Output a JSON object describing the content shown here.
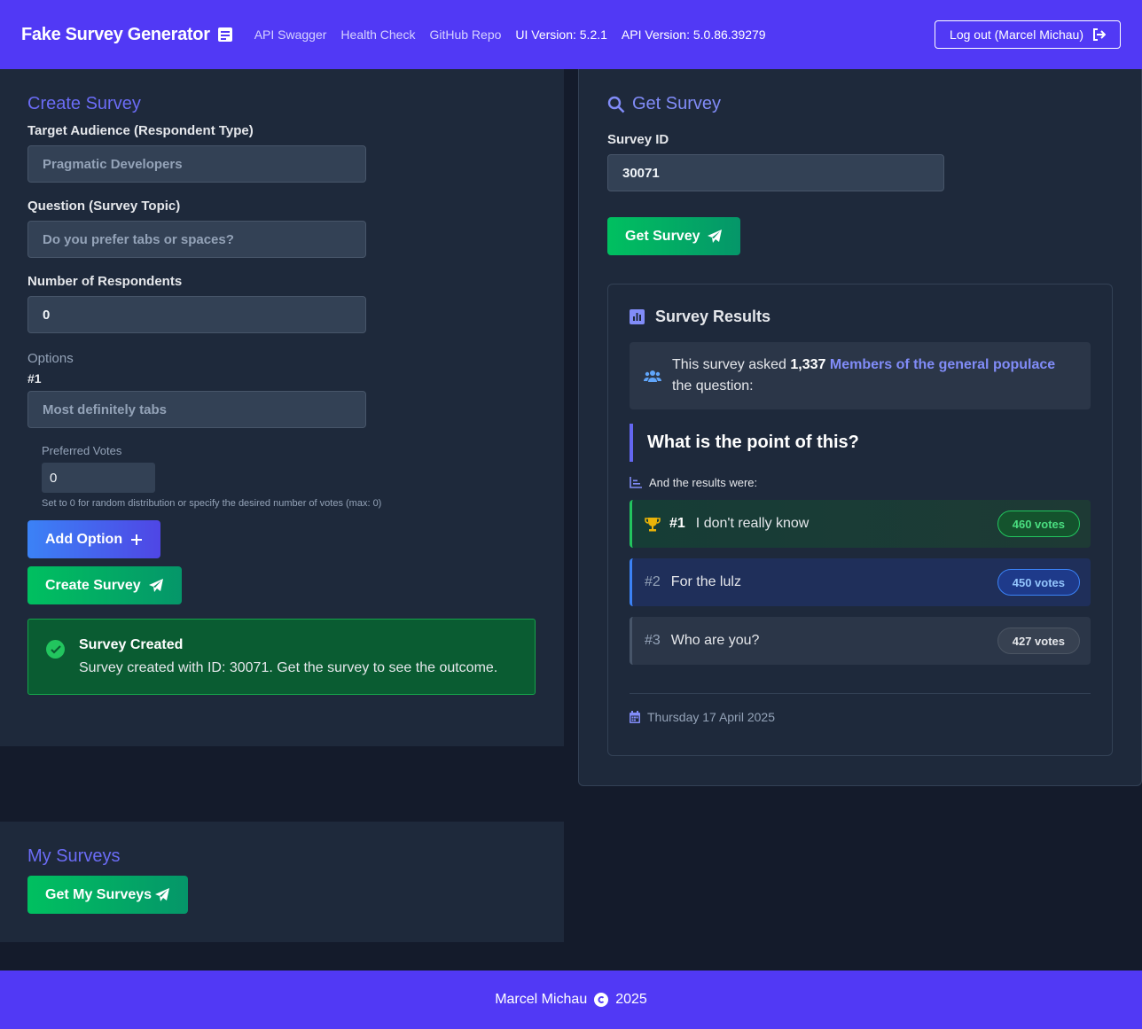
{
  "navbar": {
    "brand": "Fake Survey Generator",
    "links": [
      "API Swagger",
      "Health Check",
      "GitHub Repo"
    ],
    "ui_version": "UI Version: 5.2.1",
    "api_version": "API Version: 5.0.86.39279",
    "logout_label": "Log out (Marcel Michau)"
  },
  "create": {
    "title": "Create Survey",
    "audience_label": "Target Audience (Respondent Type)",
    "audience_placeholder": "Pragmatic Developers",
    "question_label": "Question (Survey Topic)",
    "question_placeholder": "Do you prefer tabs or spaces?",
    "respondents_label": "Number of Respondents",
    "respondents_value": "0",
    "options_label": "Options",
    "option_number": "#1",
    "option_placeholder": "Most definitely tabs",
    "preferred_votes_label": "Preferred Votes",
    "preferred_votes_value": "0",
    "preferred_votes_help": "Set to 0 for random distribution or specify the desired number of votes (max: 0)",
    "add_option_label": "Add Option",
    "create_label": "Create Survey",
    "alert_title": "Survey Created",
    "alert_text": "Survey created with ID: 30071. Get the survey to see the outcome."
  },
  "my_surveys": {
    "title": "My Surveys",
    "button_label": "Get My Surveys"
  },
  "get": {
    "title": "Get Survey",
    "id_label": "Survey ID",
    "id_value": "30071",
    "button_label": "Get Survey"
  },
  "results": {
    "title": "Survey Results",
    "info_prefix": "This survey asked",
    "respondent_count": "1,337",
    "audience": "Members of the general populace",
    "info_suffix": "the question:",
    "question": "What is the point of this?",
    "subtitle": "And the results were:",
    "rows": [
      {
        "rank": "#1",
        "label": "I don't really know",
        "votes": "460 votes"
      },
      {
        "rank": "#2",
        "label": "For the lulz",
        "votes": "450 votes"
      },
      {
        "rank": "#3",
        "label": "Who are you?",
        "votes": "427 votes"
      }
    ],
    "date": "Thursday 17 April 2025"
  },
  "footer": {
    "author": "Marcel Michau",
    "year": "2025"
  },
  "colors": {
    "brand": "#5139f5",
    "accent": "#6366f1",
    "success": "#22c55e",
    "panel": "#1e293b"
  }
}
